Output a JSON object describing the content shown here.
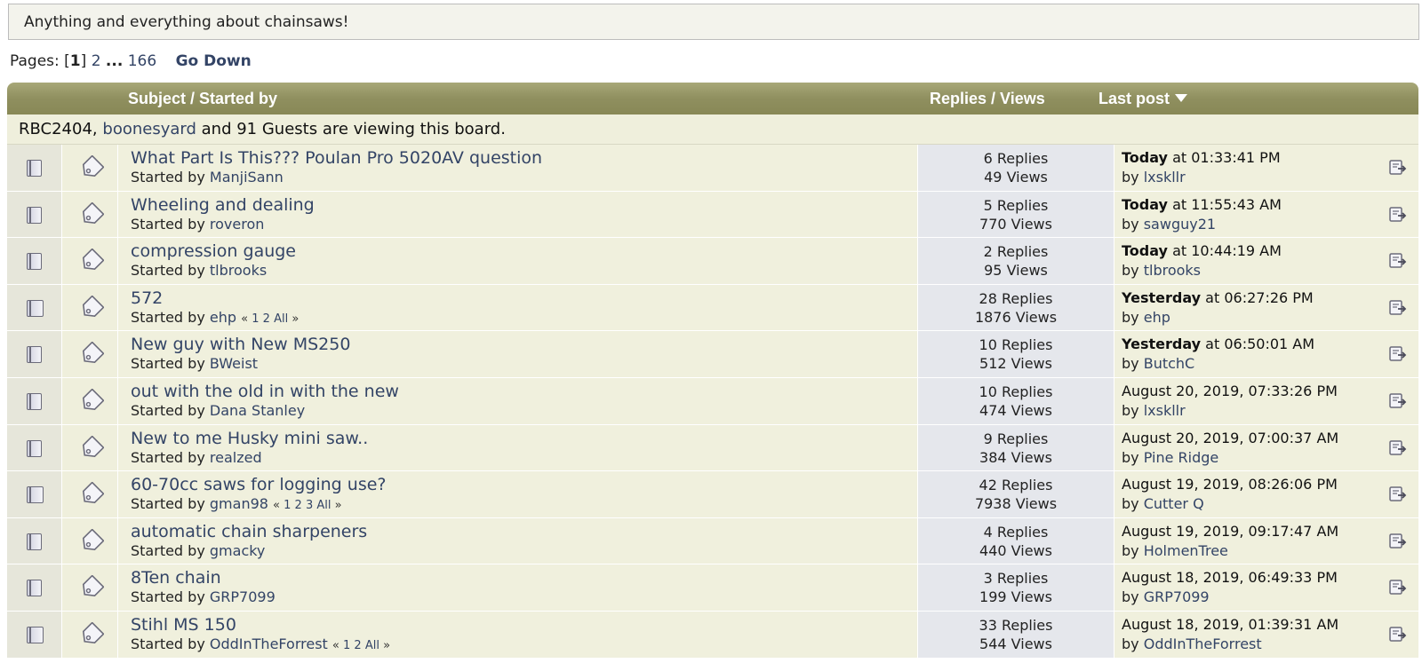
{
  "board_description": "Anything and everything about chainsaws!",
  "pagination": {
    "label": "Pages:",
    "open_bracket": "[",
    "current": "1",
    "close_bracket": "]",
    "next": "2",
    "ellipsis": "...",
    "last": "166",
    "go_down": "Go Down"
  },
  "header": {
    "subject": "Subject / Started by",
    "replies_views": "Replies / Views",
    "last_post": "Last post"
  },
  "viewers": {
    "user1": "RBC2404",
    "sep": ",",
    "user2": "boonesyard",
    "rest": "and 91 Guests are viewing this board."
  },
  "labels": {
    "started_by": "Started by",
    "by": "by",
    "replies_suffix": "Replies",
    "views_suffix": "Views",
    "at": "at",
    "all": "All"
  },
  "topics": [
    {
      "title": "What Part Is This??? Poulan Pro 5020AV question",
      "starter": "ManjiSann",
      "pages": null,
      "replies": "6 Replies",
      "views": "49 Views",
      "day": "Today",
      "time": "at 01:33:41 PM",
      "last_by": "lxskllr",
      "hot": false
    },
    {
      "title": "Wheeling and dealing",
      "starter": "roveron",
      "pages": null,
      "replies": "5 Replies",
      "views": "770 Views",
      "day": "Today",
      "time": "at 11:55:43 AM",
      "last_by": "sawguy21",
      "hot": false
    },
    {
      "title": "compression gauge",
      "starter": "tlbrooks",
      "pages": null,
      "replies": "2 Replies",
      "views": "95 Views",
      "day": "Today",
      "time": "at 10:44:19 AM",
      "last_by": "tlbrooks",
      "hot": false
    },
    {
      "title": "572",
      "starter": "ehp",
      "pages": [
        "1",
        "2"
      ],
      "replies": "28 Replies",
      "views": "1876 Views",
      "day": "Yesterday",
      "time": "at 06:27:26 PM",
      "last_by": "ehp",
      "hot": true
    },
    {
      "title": "New guy with New MS250",
      "starter": "BWeist",
      "pages": null,
      "replies": "10 Replies",
      "views": "512 Views",
      "day": "Yesterday",
      "time": "at 06:50:01 AM",
      "last_by": "ButchC",
      "hot": false
    },
    {
      "title": "out with the old in with the new",
      "starter": "Dana Stanley",
      "pages": null,
      "replies": "10 Replies",
      "views": "474 Views",
      "day": "",
      "time": "August 20, 2019, 07:33:26 PM",
      "last_by": "lxskllr",
      "hot": false
    },
    {
      "title": "New to me Husky mini saw..",
      "starter": "realzed",
      "pages": null,
      "replies": "9 Replies",
      "views": "384 Views",
      "day": "",
      "time": "August 20, 2019, 07:00:37 AM",
      "last_by": "Pine Ridge",
      "hot": false
    },
    {
      "title": "60-70cc saws for logging use?",
      "starter": "gman98",
      "pages": [
        "1",
        "2",
        "3"
      ],
      "replies": "42 Replies",
      "views": "7938 Views",
      "day": "",
      "time": "August 19, 2019, 08:26:06 PM",
      "last_by": "Cutter Q",
      "hot": true
    },
    {
      "title": "automatic chain sharpeners",
      "starter": "gmacky",
      "pages": null,
      "replies": "4 Replies",
      "views": "440 Views",
      "day": "",
      "time": "August 19, 2019, 09:17:47 AM",
      "last_by": "HolmenTree",
      "hot": false
    },
    {
      "title": "8Ten chain",
      "starter": "GRP7099",
      "pages": null,
      "replies": "3 Replies",
      "views": "199 Views",
      "day": "",
      "time": "August 18, 2019, 06:49:33 PM",
      "last_by": "GRP7099",
      "hot": false
    },
    {
      "title": "Stihl MS 150",
      "starter": "OddInTheForrest",
      "pages": [
        "1",
        "2"
      ],
      "replies": "33 Replies",
      "views": "544 Views",
      "day": "",
      "time": "August 18, 2019, 01:39:31 AM",
      "last_by": "OddInTheForrest",
      "hot": true
    }
  ],
  "icons": {
    "topic": "document-icon",
    "message": "tag-icon",
    "goto_last": "goto-last-post-icon",
    "sort": "sort-desc-icon"
  },
  "colors": {
    "header_bg": "#8f8f5f",
    "row_bg": "#f0f0dd",
    "stats_bg": "#e5e7ec",
    "link": "#334466"
  }
}
